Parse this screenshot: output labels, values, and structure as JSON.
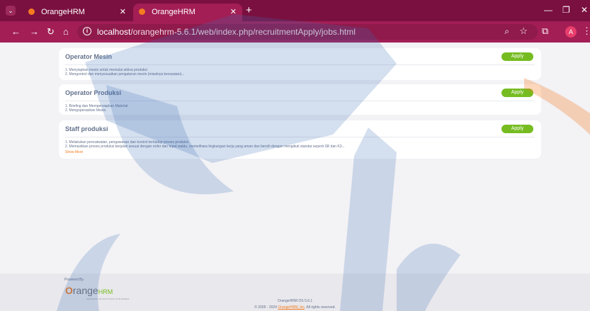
{
  "browser": {
    "tabs": [
      {
        "label": "OrangeHRM",
        "active": false
      },
      {
        "label": "OrangeHRM",
        "active": true
      }
    ],
    "url_host": "localhost",
    "url_path": "/orangehrm-5.6.1/web/index.php/recruitmentApply/jobs.html",
    "profile_initial": "A"
  },
  "jobs": [
    {
      "title": "Operator Mesin",
      "apply_label": "Apply",
      "lines": [
        "1. Menyiapkan mesin untuk memulai aktiva produksi",
        "2. Mengontrol dan menyesuaikan pengaturan mesin (misalnya kecepatan)..."
      ]
    },
    {
      "title": "Operator Produksi",
      "apply_label": "Apply",
      "lines": [
        "1. Briefing dan Mempersiapkan Material",
        "2. Mengoperasikan Mesin."
      ]
    },
    {
      "title": "Staff produksi",
      "apply_label": "Apply",
      "lines": [
        "1. Melakukan pencatwalan, pengawasan dan kontrol terhadap proses produksi",
        "2. Memastikan proses produksi berjalan sesuai dengan order dan tepat waktu, memelihara lingkungan kerja yang aman dan bersih dengan mengikuti standar seperti SR dan K3..."
      ],
      "show_more": "Show More"
    }
  ],
  "footer": {
    "powered_by": "Powered By",
    "logo_main": "range",
    "logo_o": "O",
    "logo_hrm": "HRM",
    "logo_tag": "SEAMLESS HR SOLUTIONS OF BUSINESS",
    "version": "OrangeHRM OS 5.6.1",
    "copyright_pre": "© 2005 - 2024",
    "copyright_link": "OrangeHRM, Inc",
    "copyright_post": ". All rights reserved."
  },
  "colors": {
    "brand_dark": "#7a1040",
    "brand": "#a21e55",
    "apply_green": "#76bc21",
    "orange": "#f47b20"
  }
}
